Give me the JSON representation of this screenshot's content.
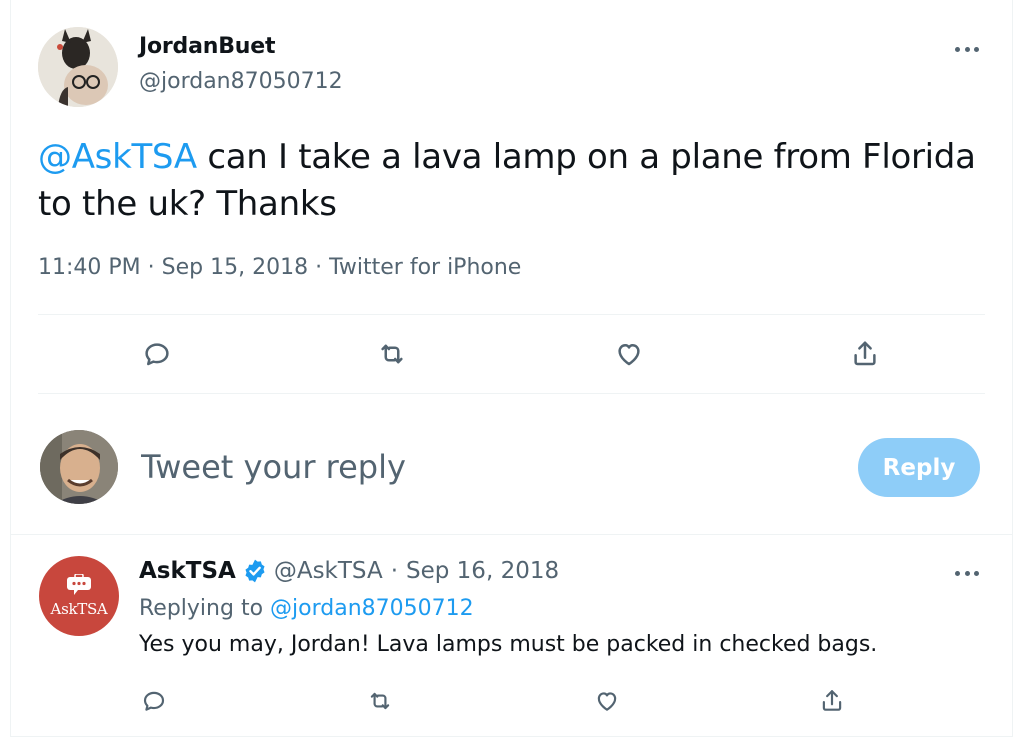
{
  "main_tweet": {
    "author_name": "JordanBuet",
    "author_handle": "@jordan87050712",
    "mention": "@AskTSA",
    "text": " can I take a lava lamp on a plane from Florida to the uk? Thanks",
    "time": "11:40 PM",
    "separator": "·",
    "date": "Sep 15, 2018",
    "source": "Twitter for iPhone",
    "actions": [
      "reply-icon",
      "retweet-icon",
      "like-icon",
      "share-icon"
    ]
  },
  "composer": {
    "placeholder": "Tweet your reply",
    "button_label": "Reply",
    "button_color": "#8ecdf8"
  },
  "reply_tweet": {
    "author_name": "AskTSA",
    "verified": true,
    "author_handle": "@AskTSA",
    "separator": "·",
    "date": "Sep 16, 2018",
    "replying_prefix": "Replying to ",
    "replying_handle": "@jordan87050712",
    "text": "Yes you may, Jordan! Lava lamps must be packed in checked bags.",
    "avatar_logo_text": "AskTSA",
    "actions": [
      "reply-icon",
      "retweet-icon",
      "like-icon",
      "share-icon"
    ]
  },
  "colors": {
    "link": "#1d9bf0",
    "secondary_text": "#536471",
    "tsa_avatar": "#c8473d"
  }
}
